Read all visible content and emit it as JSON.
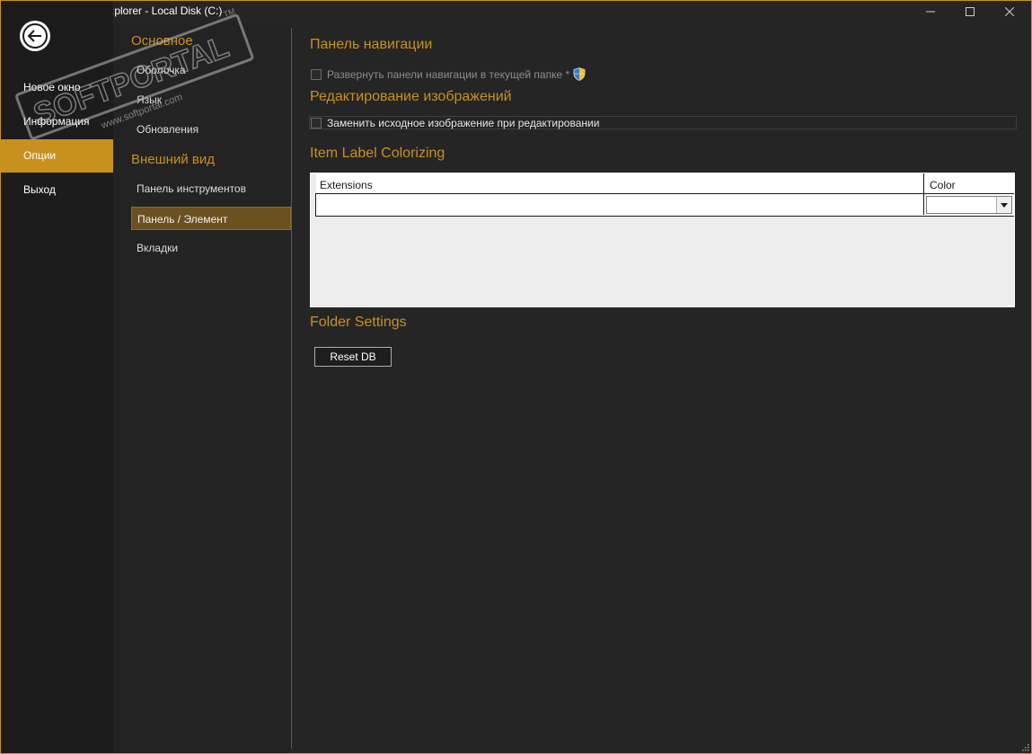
{
  "window": {
    "title": ":plorer - Local Disk (C:)",
    "accent_color": "#c8911e"
  },
  "left_menu": {
    "back_icon": "back-arrow-icon",
    "items": [
      {
        "label": "Новое окно"
      },
      {
        "label": "Информация"
      },
      {
        "label": "Опции",
        "active": true
      },
      {
        "label": "Выход"
      }
    ]
  },
  "categories": {
    "general_heading": "Основное",
    "general_items": [
      "Оболочка",
      "Язык",
      "Обновления"
    ],
    "appearance_heading": "Внешний вид",
    "appearance_items": [
      "Панель инструментов",
      "Панель / Элемент",
      "Вкладки"
    ],
    "selected": "Панель / Элемент"
  },
  "content": {
    "nav_panel": {
      "heading": "Панель навигации",
      "expand_checkbox_label": "Развернуть панели навигации в текущей папке *",
      "expand_checked": false
    },
    "image_editing": {
      "heading": "Редактирование изображений",
      "replace_checkbox_label": "Заменить исходное изображение при редактировании",
      "replace_checked": false
    },
    "colorizing": {
      "heading": "Item Label Colorizing",
      "col_extensions": "Extensions",
      "col_color": "Color",
      "rows": [
        {
          "extensions": "",
          "color": ""
        }
      ]
    },
    "folder_settings": {
      "heading": "Folder Settings",
      "reset_button": "Reset DB"
    }
  },
  "watermark": {
    "brand": "SOFTPORTAL",
    "url": "www.softportal.com",
    "tm": "TM"
  }
}
